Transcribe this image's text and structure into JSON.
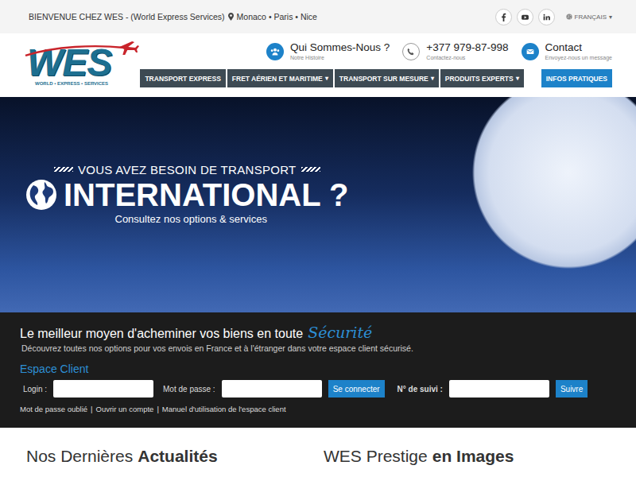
{
  "top_bar": {
    "welcome": "BIENVENUE CHEZ WES - (World Express Services)",
    "locations": "Monaco • Paris • Nice",
    "language": "FRANÇAIS",
    "language_caret": "▾"
  },
  "social": [
    {
      "kind": "facebook"
    },
    {
      "kind": "youtube"
    },
    {
      "kind": "linkedin"
    }
  ],
  "logo": {
    "name": "WES",
    "tagline": "WORLD • EXPRESS • SERVICES"
  },
  "header_links": [
    {
      "kind": "about",
      "title": "Qui Sommes-Nous ?",
      "subtitle": "Notre Histoire"
    },
    {
      "kind": "phone",
      "title": "+377 979-87-998",
      "subtitle": "Contactez-nous"
    },
    {
      "kind": "contact",
      "title": "Contact",
      "subtitle": "Envoyez-nous un message"
    }
  ],
  "nav": {
    "caret": "▾",
    "items": [
      {
        "label": "TRANSPORT EXPRESS",
        "dropdown": false,
        "highlighted": false
      },
      {
        "label": "FRET AÉRIEN ET MARITIME",
        "dropdown": true,
        "highlighted": false
      },
      {
        "label": "TRANSPORT SUR MESURE",
        "dropdown": true,
        "highlighted": false
      },
      {
        "label": "PRODUITS EXPERTS",
        "dropdown": true,
        "highlighted": false
      },
      {
        "label": "INFOS PRATIQUES",
        "dropdown": false,
        "highlighted": true
      }
    ]
  },
  "hero": {
    "kicker": "VOUS AVEZ BESOIN DE TRANSPORT",
    "title": "INTERNATIONAL ?",
    "subtitle": "Consultez nos options & services"
  },
  "client": {
    "headline": "Le meilleur moyen d'acheminer vos biens en toute",
    "headline_accent": "Sécurité",
    "description": "Découvrez toutes nos options pour vos envois en France et à l'étranger dans votre espace client sécurisé.",
    "title": "Espace Client",
    "login_label": "Login :",
    "password_label": "Mot de passe :",
    "login_button": "Se connecter",
    "tracking_label": "N° de suivi :",
    "tracking_button": "Suivre",
    "links": [
      "Mot de passe oublié",
      "Ouvrir un compte",
      "Manuel d'utilisation de l'espace client"
    ],
    "link_separator": "|"
  },
  "sections": [
    {
      "light": "Nos Dernières",
      "bold": "Actualités"
    },
    {
      "light": "WES Prestige",
      "bold": "en Images"
    }
  ]
}
